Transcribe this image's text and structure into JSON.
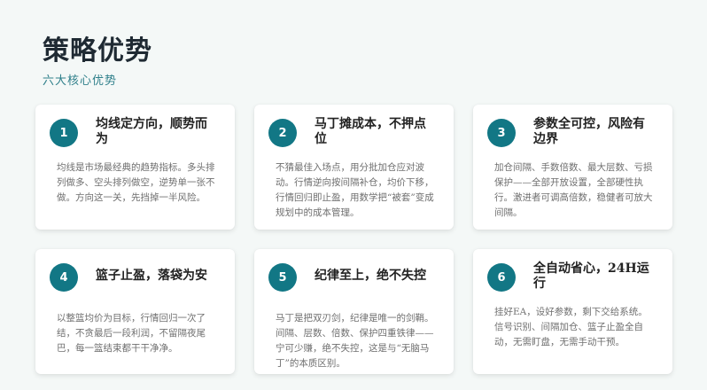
{
  "page": {
    "title": "策略优势",
    "subtitle": "六大核心优势"
  },
  "cards": [
    {
      "number": "1",
      "title": "均线定方向，顺势而为",
      "description": "均线是市场最经典的趋势指标。多头排列做多、空头排列做空，逆势单一张不做。方向这一关，先挡掉一半风险。"
    },
    {
      "number": "2",
      "title": "马丁摊成本，不押点位",
      "description": "不猜最佳入场点，用分批加仓应对波动。行情逆向按间隔补仓，均价下移，行情回归即止盈，用数学把“被套”变成规划中的成本管理。"
    },
    {
      "number": "3",
      "title": "参数全可控，风险有边界",
      "description": "加仓间隔、手数倍数、最大层数、亏损保护——全部开放设置，全部硬性执行。激进者可调高倍数，稳健者可放大间隔。"
    },
    {
      "number": "4",
      "title": "篮子止盈，落袋为安",
      "description": "以整篮均价为目标，行情回归一次了结，不贪最后一段利润，不留隔夜尾巴，每一篮结束都干干净净。"
    },
    {
      "number": "5",
      "title": "纪律至上，绝不失控",
      "description": "马丁是把双刃剑，纪律是唯一的剑鞘。间隔、层数、倍数、保护四重铁律——宁可少赚，绝不失控，这是与“无脑马丁”的本质区别。"
    },
    {
      "number": "6",
      "title": "全自动省心，24H运行",
      "description": "挂好EA，设好参数，剩下交给系统。信号识别、间隔加仓、篮子止盈全自动，无需盯盘，无需手动干预。"
    }
  ]
}
